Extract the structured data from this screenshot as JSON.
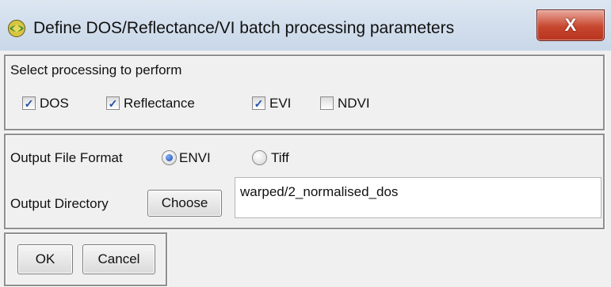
{
  "window": {
    "title": "Define DOS/Reflectance/VI batch processing parameters",
    "close_label": "X",
    "icon": "idl-globe-icon"
  },
  "processing": {
    "heading": "Select processing to perform",
    "options": [
      {
        "label": "DOS",
        "checked": true
      },
      {
        "label": "Reflectance",
        "checked": true
      },
      {
        "label": "EVI",
        "checked": true
      },
      {
        "label": "NDVI",
        "checked": false
      }
    ]
  },
  "output": {
    "format_label": "Output File Format",
    "formats": [
      {
        "label": "ENVI",
        "selected": true
      },
      {
        "label": "Tiff",
        "selected": false
      }
    ],
    "directory_label": "Output Directory",
    "choose_label": "Choose",
    "directory_value": "warped/2_normalised_dos"
  },
  "actions": {
    "ok_label": "OK",
    "cancel_label": "Cancel"
  },
  "colors": {
    "titlebar": "#c9d7e8",
    "close_button": "#c7472f",
    "check": "#2150a8",
    "radio_selected": "#1a46a8"
  }
}
